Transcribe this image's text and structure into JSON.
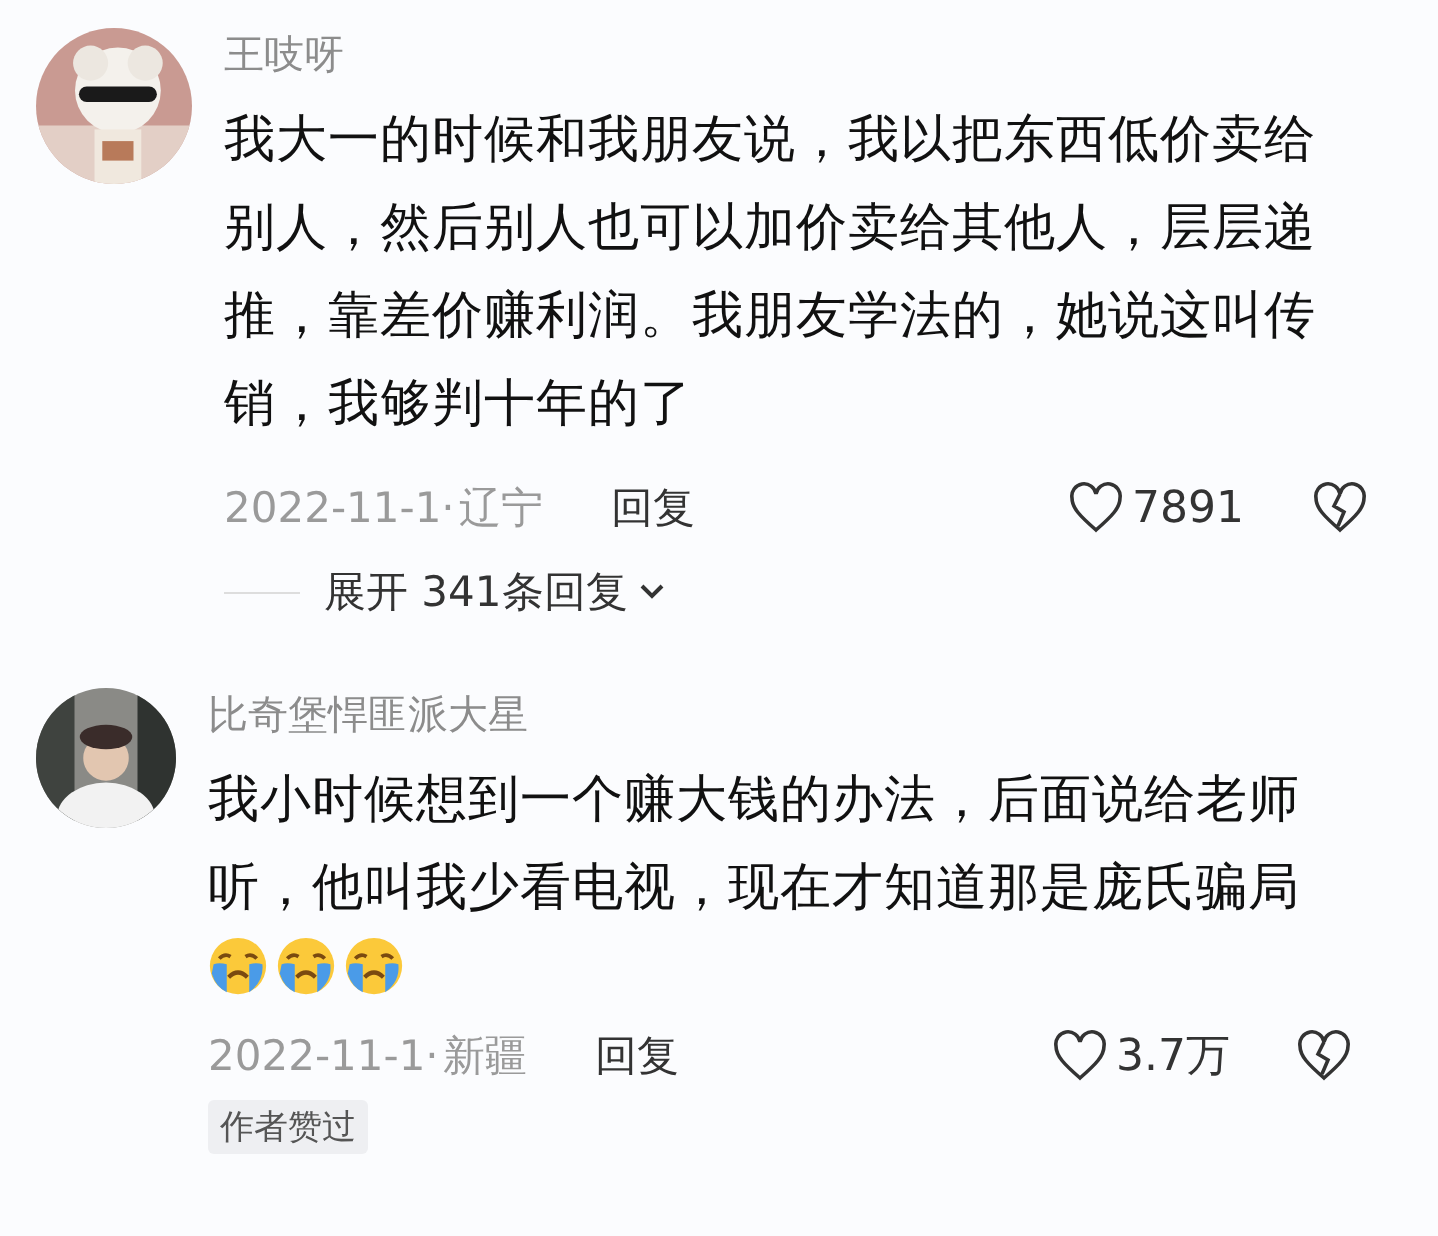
{
  "comments": [
    {
      "username": "王吱呀",
      "text": "我大一的时候和我朋友说，我以把东西低价卖给别人，然后别人也可以加价卖给其他人，层层递推，靠差价赚利润。我朋友学法的，她说这叫传销，我够判十年的了",
      "date": "2022-11-1·",
      "location": "辽宁",
      "reply": "回复",
      "likes": "7891",
      "expand": {
        "label": "展开 341条回复"
      }
    },
    {
      "username": "比奇堡悍匪派大星",
      "text": "我小时候想到一个赚大钱的办法，后面说给老师听，他叫我少看电视，现在才知道那是庞氏骗局",
      "emojis": [
        {
          "kind": "crying"
        },
        {
          "kind": "crying"
        },
        {
          "kind": "crying"
        }
      ],
      "date": "2022-11-1·",
      "location": "新疆",
      "reply": "回复",
      "likes": "3.7万",
      "badge": "作者赞过"
    }
  ]
}
